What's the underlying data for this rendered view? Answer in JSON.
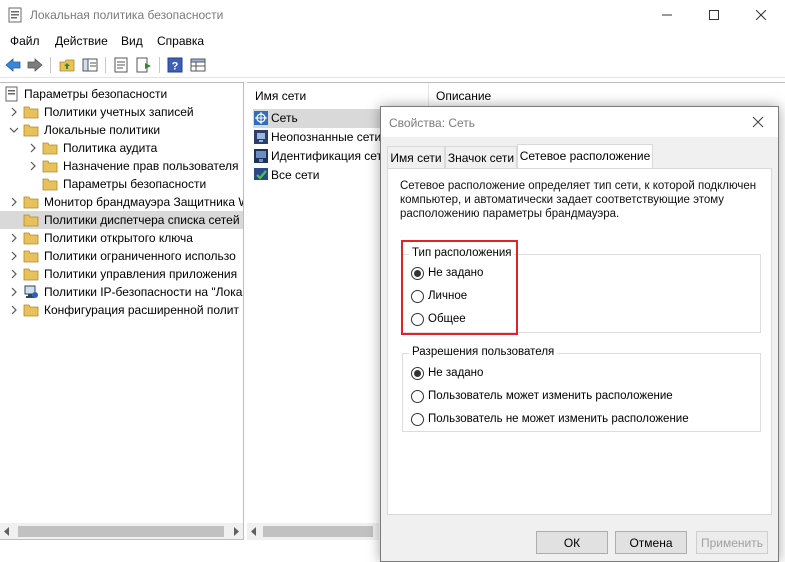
{
  "window": {
    "title": "Локальная политика безопасности",
    "minimize_icon": "minimize-icon",
    "maximize_icon": "maximize-icon",
    "close_icon": "close-icon"
  },
  "menu": {
    "items": [
      "Файл",
      "Действие",
      "Вид",
      "Справка"
    ]
  },
  "toolbar": {
    "icons": [
      "back-arrow-icon",
      "forward-arrow-icon",
      "up-folder-icon",
      "show-tree-icon",
      "properties-icon",
      "export-list-icon",
      "help-icon",
      "console-view-icon"
    ]
  },
  "tree": {
    "root_label": "Параметры безопасности",
    "items": [
      {
        "label": "Политики учетных записей"
      },
      {
        "label": "Локальные политики"
      },
      {
        "label": "Политика аудита"
      },
      {
        "label": "Назначение прав пользователя"
      },
      {
        "label": "Параметры безопасности"
      },
      {
        "label": "Монитор брандмауэра Защитника W"
      },
      {
        "label": "Политики диспетчера списка сетей"
      },
      {
        "label": "Политики открытого ключа"
      },
      {
        "label": "Политики ограниченного использо"
      },
      {
        "label": "Политики управления приложения"
      },
      {
        "label": "Политики IP-безопасности на \"Лока"
      },
      {
        "label": "Конфигурация расширенной полит"
      }
    ]
  },
  "list": {
    "columns": [
      "Имя сети",
      "Описание"
    ],
    "rows": [
      {
        "label": "Сеть"
      },
      {
        "label": "Неопознанные сети"
      },
      {
        "label": "Идентификация сет"
      },
      {
        "label": "Все сети"
      }
    ]
  },
  "dialog": {
    "title": "Свойства: Сеть",
    "tabs": [
      "Имя сети",
      "Значок сети",
      "Сетевое расположение"
    ],
    "description_lines": [
      "Сетевое расположение определяет тип сети, к которой подключен",
      "компьютер, и автоматически задает соответствующие этому",
      "расположению параметры брандмауэра."
    ],
    "location_group": {
      "legend": "Тип расположения",
      "options": [
        "Не задано",
        "Личное",
        "Общее"
      ],
      "selected": 0
    },
    "permissions_group": {
      "legend": "Разрешения пользователя",
      "options": [
        "Не задано",
        "Пользователь может изменить расположение",
        "Пользователь не может изменить расположение"
      ],
      "selected": 0
    },
    "buttons": {
      "ok": "ОК",
      "cancel": "Отмена",
      "apply": "Применить"
    }
  },
  "colors": {
    "highlight": "#e0222c",
    "selection": "#d9d9d9",
    "folder": "#e8c15a"
  }
}
